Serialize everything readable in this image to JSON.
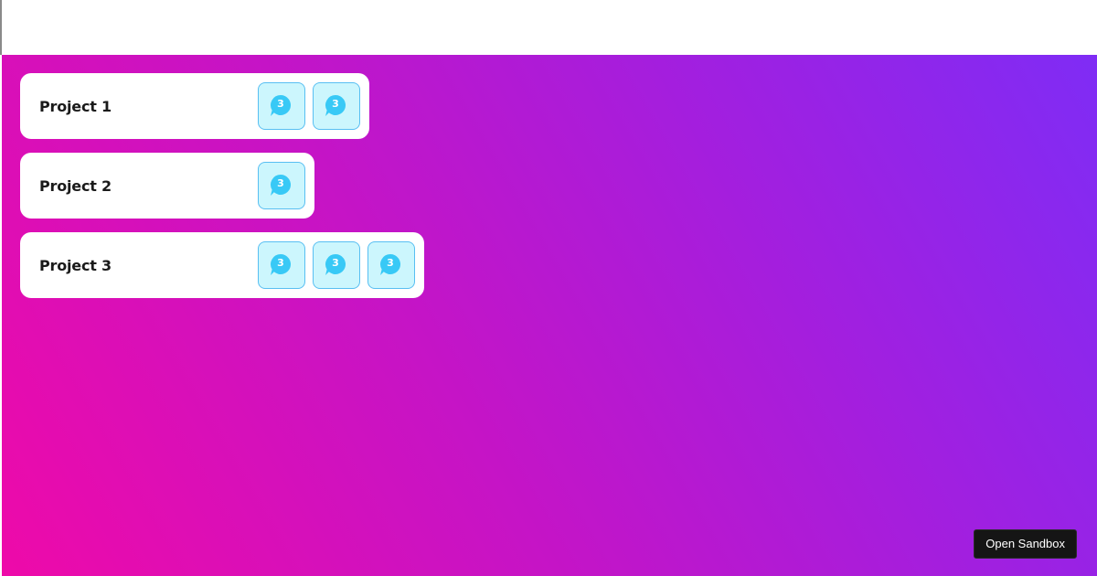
{
  "projects": [
    {
      "name": "Project 1",
      "badges": [
        {
          "icon": "chat-bubble-icon",
          "count": "3"
        },
        {
          "icon": "chat-bubble-icon",
          "count": "3"
        }
      ]
    },
    {
      "name": "Project 2",
      "badges": [
        {
          "icon": "chat-bubble-icon",
          "count": "3"
        }
      ]
    },
    {
      "name": "Project 3",
      "badges": [
        {
          "icon": "chat-bubble-icon",
          "count": "3"
        },
        {
          "icon": "chat-bubble-icon",
          "count": "3"
        },
        {
          "icon": "chat-bubble-icon",
          "count": "3"
        }
      ]
    }
  ],
  "sandbox_button": {
    "label": "Open Sandbox"
  },
  "colors": {
    "gradient_start": "#ee0aa9",
    "gradient_end": "#7f2cf5",
    "badge_background": "#ccf6fd",
    "badge_border": "#58bff2",
    "bubble_fill": "#38c9f6"
  }
}
